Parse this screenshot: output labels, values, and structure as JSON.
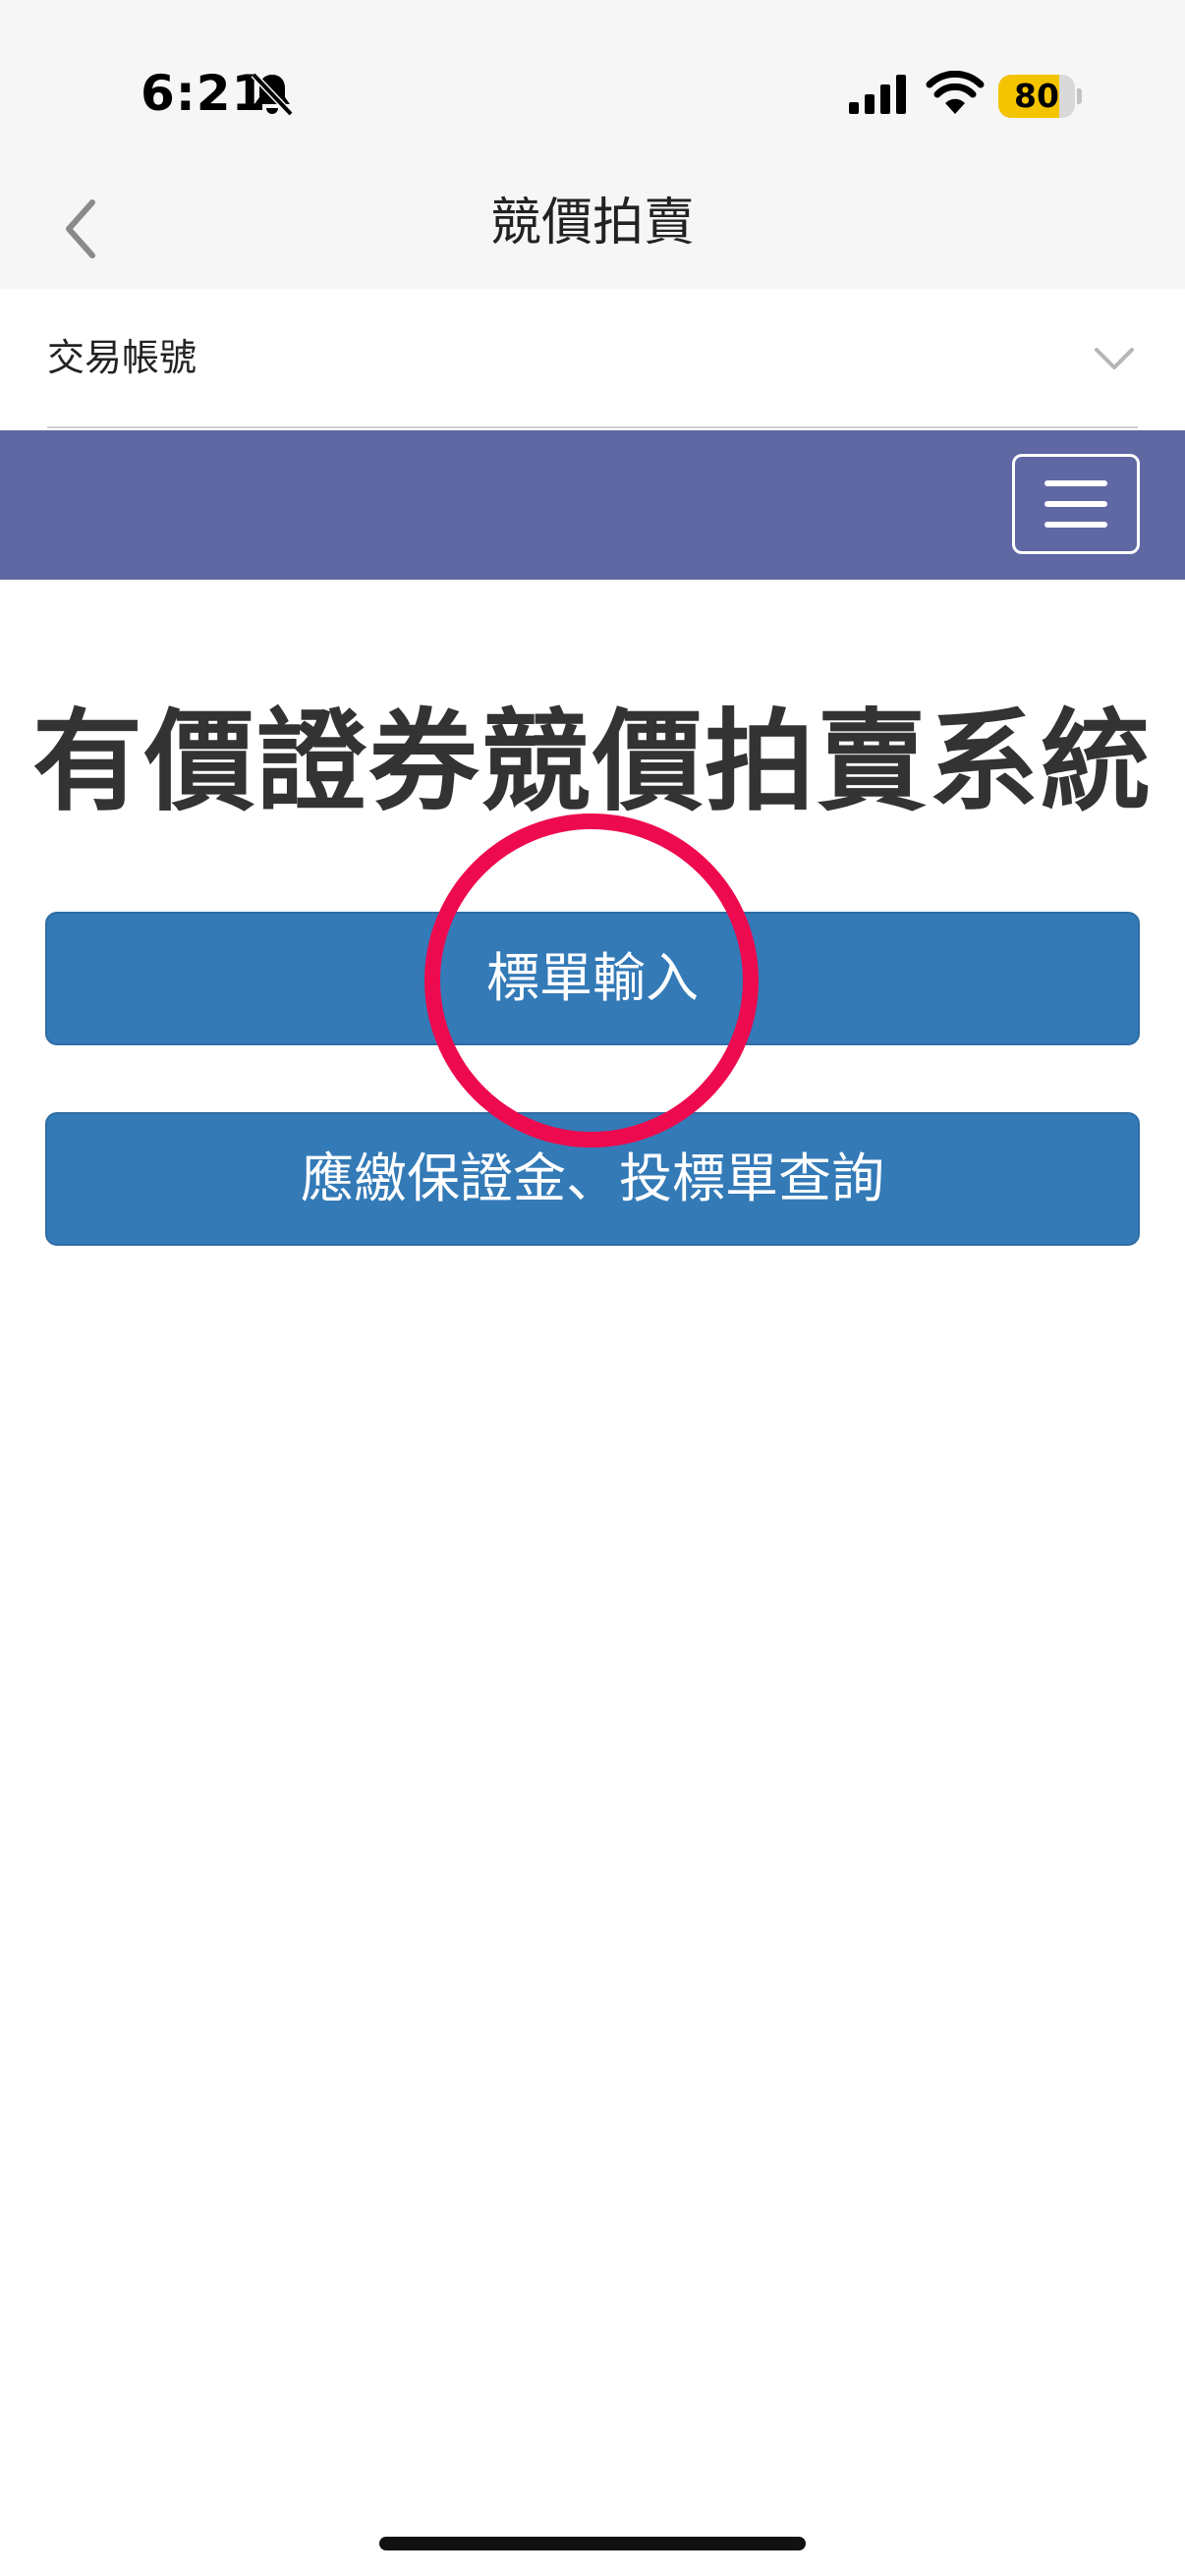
{
  "status_bar": {
    "time": "6:21",
    "battery_level": "80",
    "battery_fraction": 0.8,
    "icons": [
      "bell-slash-icon",
      "cellular-signal-icon",
      "wifi-icon",
      "battery-icon"
    ]
  },
  "nav": {
    "title": "競價拍賣",
    "back_icon": "chevron-left-icon"
  },
  "account": {
    "label": "交易帳號",
    "dropdown_icon": "chevron-down-icon"
  },
  "menu": {
    "icon": "hamburger-menu-icon"
  },
  "main": {
    "title": "有價證券競價拍賣系統",
    "buttons": {
      "bid_entry": "標單輸入",
      "deposit_query": "應繳保證金、投標單查詢"
    }
  },
  "colors": {
    "menu_bar": "#5f68a3",
    "button": "#337ab7",
    "highlight": "#ee0a4e",
    "battery": "#f5c400"
  }
}
